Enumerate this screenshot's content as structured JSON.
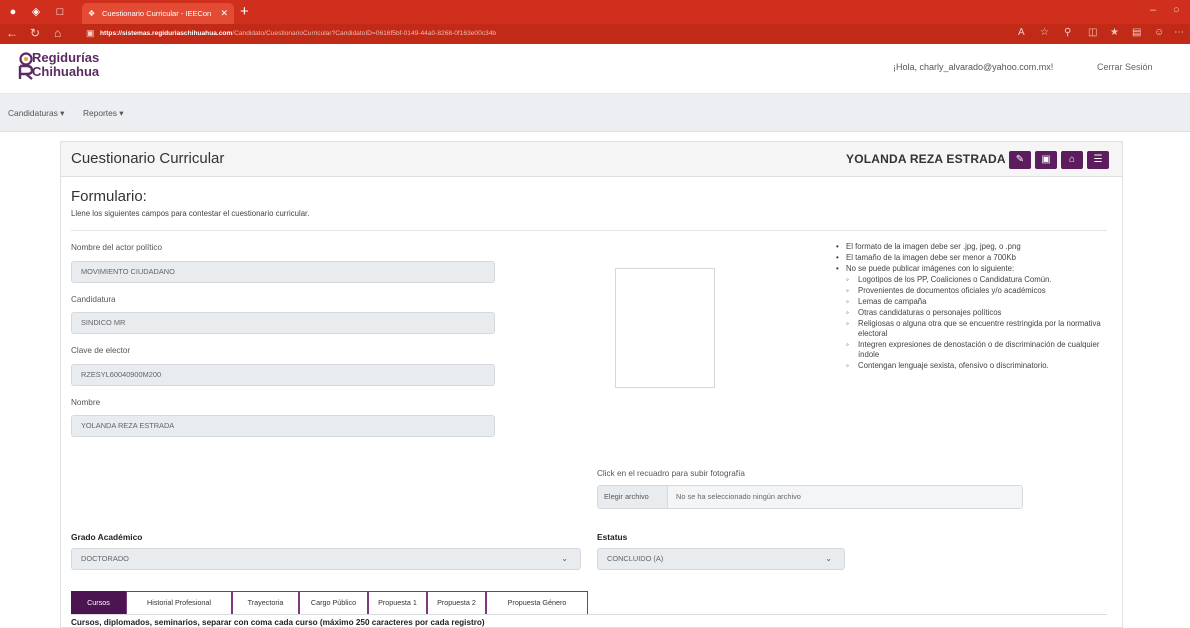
{
  "browser": {
    "tab_title": "Cuestionario Curricular - IEECon",
    "url_domain": "https://sistemas.regiduriaschihuahua.com",
    "url_path": "/Candidato/CuestionarioCurricular?CandidatoID=0616f5bf-0149-44a0-8268-0f163e00c34b"
  },
  "header": {
    "logo_line1": "Regidurías",
    "logo_line2": "Chihuahua",
    "greeting": "¡Hola, charly_alvarado@yahoo.com.mx!",
    "logout": "Cerrar Sesión"
  },
  "nav": {
    "items": [
      "Candidaturas ▾",
      "Reportes ▾"
    ]
  },
  "card": {
    "title": "Cuestionario Curricular",
    "candidate_name": "YOLANDA REZA ESTRADA",
    "action_icons": [
      "edit-icon",
      "save-icon",
      "home-icon",
      "document-icon"
    ]
  },
  "form": {
    "title": "Formulario:",
    "subtitle": "Llene los siguientes campos para contestar el cuestionario curricular.",
    "fields": {
      "actor_label": "Nombre del actor político",
      "actor_value": "MOVIMIENTO CIUDADANO",
      "candidatura_label": "Candidatura",
      "candidatura_value": "SINDICO MR",
      "clave_label": "Clave de elector",
      "clave_value": "RZESYL60040900M200",
      "nombre_label": "Nombre",
      "nombre_value": "YOLANDA REZA ESTRADA"
    },
    "photo": {
      "instruction": "Click en el recuadro para subir fotografía",
      "file_button": "Elegir archivo",
      "file_status": "No se ha seleccionado ningún archivo"
    },
    "rules": {
      "main": [
        "El formato de la imagen debe ser .jpg, jpeg, o .png",
        "El tamaño de la imagen debe ser menor a 700Kb",
        "No se puede publicar imágenes con lo siguiente:"
      ],
      "sub": [
        "Logotipos de los PP, Coaliciones o Candidatura Común.",
        "Provenientes de documentos oficiales y/o académicos",
        "Lemas de campaña",
        "Otras candidaturas o personajes políticos",
        "Religiosas o alguna otra que se encuentre restringida por la normativa electoral",
        "Integren expresiones de denostación o de discriminación de cualquier índole",
        "Contengan lenguaje sexista, ofensivo o discriminatorio."
      ]
    },
    "grado_label": "Grado Académico",
    "grado_value": "DOCTORADO",
    "estatus_label": "Estatus",
    "estatus_value": "CONCLUIDO (A)",
    "tabs": [
      "Cursos",
      "Historial Profesional",
      "Trayectoria",
      "Cargo Público",
      "Propuesta 1",
      "Propuesta 2",
      "Propuesta Género"
    ],
    "active_tab": "Cursos",
    "cursos_label": "Cursos, diplomados, seminarios, separar con coma cada curso (máximo 250 caracteres por cada registro)"
  },
  "colors": {
    "browser_red": "#cf2f1c",
    "brand_purple": "#4c1450",
    "logo_purple": "#5b2a63"
  }
}
